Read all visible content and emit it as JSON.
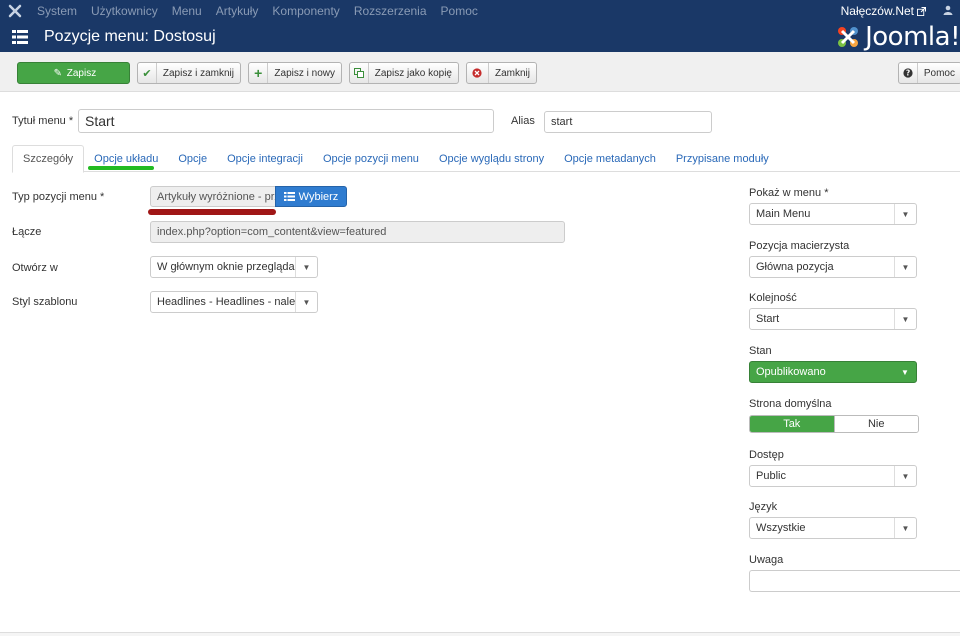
{
  "topnav": {
    "menu": [
      "System",
      "Użytkownicy",
      "Menu",
      "Artykuły",
      "Komponenty",
      "Rozszerzenia",
      "Pomoc"
    ],
    "site_name": "Nałęczów.Net",
    "colors": {
      "bar": "#1a3867",
      "item": "#8a9bb5"
    }
  },
  "header": {
    "title": "Pozycje menu: Dostosuj",
    "brand": "Joomla!"
  },
  "toolbar": {
    "save": "Zapisz",
    "save_close": "Zapisz i zamknij",
    "save_new": "Zapisz i nowy",
    "save_copy": "Zapisz jako kopię",
    "close": "Zamknij",
    "help": "Pomoc"
  },
  "form": {
    "title_label": "Tytuł menu *",
    "title_value": "Start",
    "alias_label": "Alias",
    "alias_value": "start"
  },
  "tabs": [
    "Szczegóły",
    "Opcje układu",
    "Opcje",
    "Opcje integracji",
    "Opcje pozycji menu",
    "Opcje wyglądu strony",
    "Opcje metadanych",
    "Przypisane moduły"
  ],
  "details": {
    "type_label": "Typ pozycji menu *",
    "type_value": "Artykuły wyróżnione - przeglądanie",
    "select_button": "Wybierz",
    "link_label": "Łącze",
    "link_value": "index.php?option=com_content&view=featured",
    "target_label": "Otwórz w",
    "target_value": "W głównym oknie przeglądarki",
    "style_label": "Styl szablonu",
    "style_value": "Headlines - Headlines - nalec..."
  },
  "sidebar": {
    "menu_label": "Pokaż w menu *",
    "menu_value": "Main Menu",
    "parent_label": "Pozycja macierzysta",
    "parent_value": "Główna pozycja",
    "order_label": "Kolejność",
    "order_value": "Start",
    "status_label": "Stan",
    "status_value": "Opublikowano",
    "home_label": "Strona domyślna",
    "home_yes": "Tak",
    "home_no": "Nie",
    "access_label": "Dostęp",
    "access_value": "Public",
    "language_label": "Język",
    "language_value": "Wszystkie",
    "note_label": "Uwaga",
    "note_value": ""
  },
  "accent_colors": {
    "green": "#46a546",
    "blue": "#2f7cd0",
    "link": "#2a69b8"
  }
}
